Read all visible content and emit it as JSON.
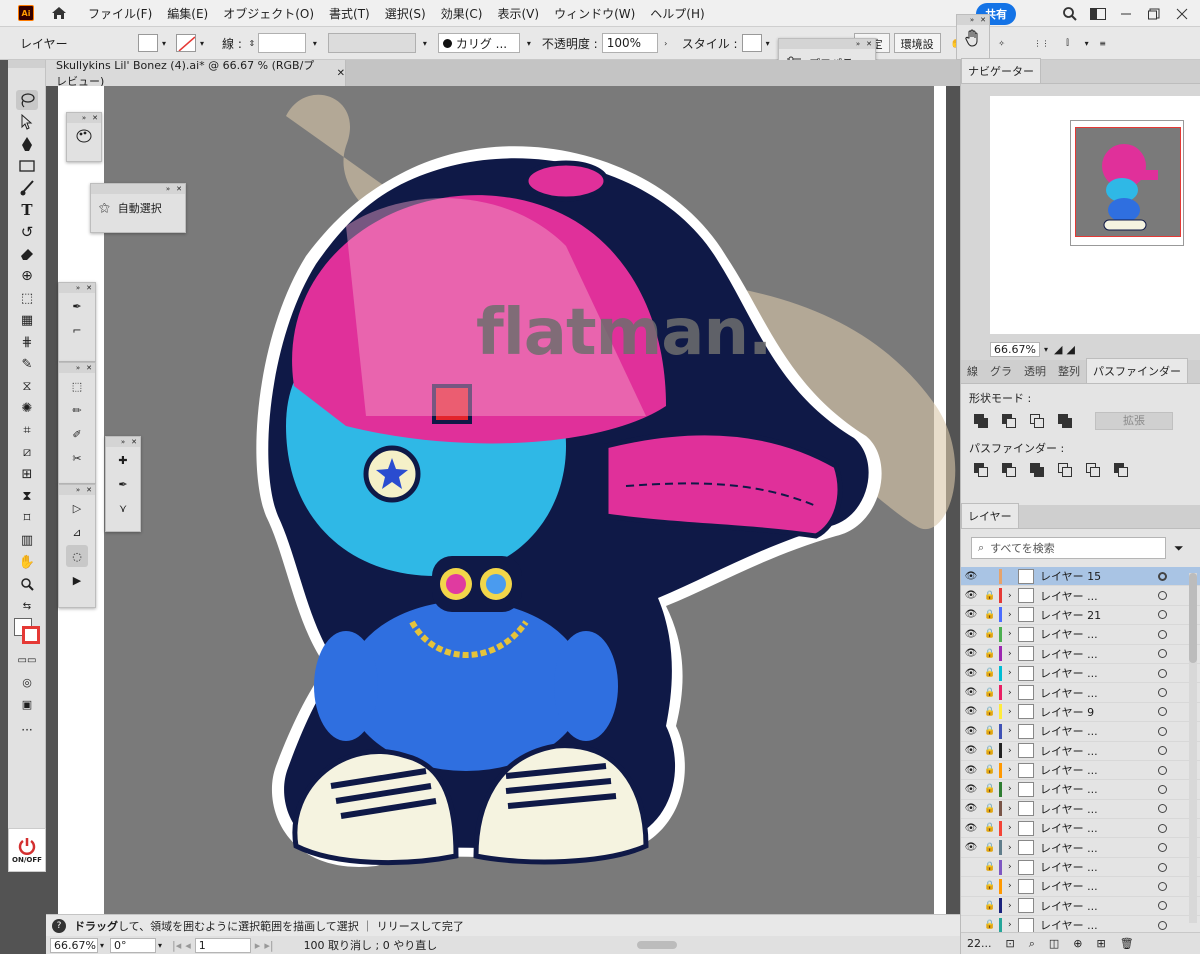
{
  "app": {
    "logo_text": "Ai",
    "share_label": "共有",
    "menu": [
      "ファイル(F)",
      "編集(E)",
      "オブジェクト(O)",
      "書式(T)",
      "選択(S)",
      "効果(C)",
      "表示(V)",
      "ウィンドウ(W)",
      "ヘルプ(H)"
    ]
  },
  "control_bar": {
    "selection_label": "レイヤー",
    "stroke_label": "線 :",
    "brush_label": "カリグ ...",
    "opacity_label": "不透明度 :",
    "opacity_value": "100%",
    "style_label": "スタイル :",
    "settings_button": "設定",
    "env_button": "環境設"
  },
  "properties_panel": {
    "label": "プロパティ"
  },
  "document": {
    "tab_title": "Skullykins Lil' Bonez (4).ai* @ 66.67 % (RGB/プレビュー)",
    "watermark": "flatman."
  },
  "floating_panels": {
    "auto_select_label": "自動選択"
  },
  "power_button": {
    "label": "ON/OFF"
  },
  "status": {
    "hint_bold": "ドラッグ",
    "hint": "して、領域を囲むように選択範囲を描画して選択 ｜ リリースして完了",
    "zoom": "66.67%",
    "rotation": "0°",
    "artboard": "1",
    "undo": "100 取り消し ; 0 やり直し"
  },
  "navigator": {
    "tab": "ナビゲーター",
    "zoom": "66.67%"
  },
  "pathfinder": {
    "tabs": [
      "線",
      "グラ",
      "透明",
      "整列",
      "パスファインダー"
    ],
    "shape_modes_label": "形状モード :",
    "expand_label": "拡張",
    "pathfinder_label": "パスファインダー :"
  },
  "layers": {
    "tab": "レイヤー",
    "search_placeholder": "すべてを検索",
    "count": "22...",
    "rows": [
      {
        "name": "レイヤー 15",
        "color": "#e6a36b",
        "visible": true,
        "locked": false,
        "selected": true
      },
      {
        "name": "レイヤー ...",
        "color": "#e53935",
        "visible": true,
        "locked": true
      },
      {
        "name": "レイヤー 21",
        "color": "#4a6cff",
        "visible": true,
        "locked": true
      },
      {
        "name": "レイヤー ...",
        "color": "#4caf50",
        "visible": true,
        "locked": true
      },
      {
        "name": "レイヤー ...",
        "color": "#9c27b0",
        "visible": true,
        "locked": true
      },
      {
        "name": "レイヤー ...",
        "color": "#00bcd4",
        "visible": true,
        "locked": true
      },
      {
        "name": "レイヤー ...",
        "color": "#e91e63",
        "visible": true,
        "locked": true
      },
      {
        "name": "レイヤー 9",
        "color": "#ffeb3b",
        "visible": true,
        "locked": true
      },
      {
        "name": "レイヤー ...",
        "color": "#3f51b5",
        "visible": true,
        "locked": true
      },
      {
        "name": "レイヤー ...",
        "color": "#212121",
        "visible": true,
        "locked": true
      },
      {
        "name": "レイヤー ...",
        "color": "#ff9800",
        "visible": true,
        "locked": true
      },
      {
        "name": "レイヤー ...",
        "color": "#2e7d32",
        "visible": true,
        "locked": true
      },
      {
        "name": "レイヤー ...",
        "color": "#795548",
        "visible": true,
        "locked": true
      },
      {
        "name": "レイヤー ...",
        "color": "#f44336",
        "visible": true,
        "locked": true
      },
      {
        "name": "レイヤー ...",
        "color": "#607d8b",
        "visible": true,
        "locked": true
      },
      {
        "name": "レイヤー ...",
        "color": "#7e57c2",
        "visible": false,
        "locked": true
      },
      {
        "name": "レイヤー ...",
        "color": "#ff9800",
        "visible": false,
        "locked": true
      },
      {
        "name": "レイヤー ...",
        "color": "#1a237e",
        "visible": false,
        "locked": true
      },
      {
        "name": "レイヤー ...",
        "color": "#26a69a",
        "visible": false,
        "locked": true
      }
    ]
  }
}
